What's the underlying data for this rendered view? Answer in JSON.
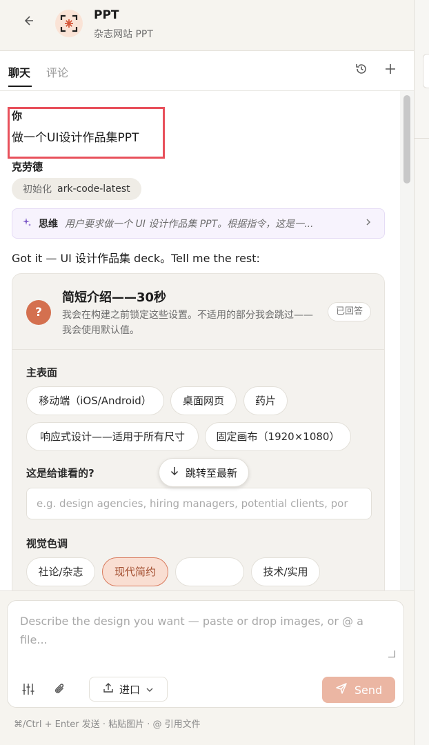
{
  "header": {
    "title": "PPT",
    "subtitle": "杂志网站 PPT"
  },
  "tabs": {
    "chat": "聊天",
    "comments": "评论"
  },
  "conversation": {
    "user_label": "你",
    "user_message": "做一个UI设计作品集PPT",
    "assistant_label": "克劳德",
    "init_key": "初始化",
    "init_value": "ark-code-latest",
    "thinking_label": "思维",
    "thinking_text": "用户要求做一个 UI 设计作品集 PPT。根据指令，这是一...",
    "reply": "Got it — UI 设计作品集 deck。Tell me the rest:"
  },
  "question_card": {
    "title": "简短介绍——30秒",
    "description": "我会在构建之前锁定这些设置。不适用的部分我会跳过——我会使用默认值。",
    "answered_badge": "已回答",
    "surface_label": "主表面",
    "surface_options": [
      "移动端（iOS/Android）",
      "桌面网页",
      "药片",
      "响应式设计——适用于所有尺寸",
      "固定画布（1920×1080）"
    ],
    "audience_label": "这是给谁看的?",
    "audience_placeholder": "e.g. design agencies, hiring managers, potential clients, por",
    "tone_label": "视觉色调",
    "tone_options": [
      "社论/杂志",
      "现代简约",
      "技术/实用"
    ],
    "tone_selected": "现代简约"
  },
  "jump_to_latest": "跳转至最新",
  "composer": {
    "placeholder": "Describe the design you want — paste or drop images, or @ a file...",
    "import_label": "进口",
    "send_label": "Send",
    "hint": "⌘/Ctrl + Enter 发送 · 粘贴图片 · @ 引用文件"
  },
  "colors": {
    "accent": "#d4704f",
    "send_disabled": "#ebb6a3",
    "highlight_box": "#e8505b",
    "thinking_accent": "#7b57c7"
  },
  "icons": {
    "back": "back-arrow-icon",
    "app": "focus-spark-icon",
    "history": "history-icon",
    "add": "plus-icon",
    "thinking": "sparkle-icon",
    "expand": "chevron-right-icon",
    "question": "question-mark-icon",
    "jump": "arrow-down-icon",
    "settings": "sliders-icon",
    "attach": "paperclip-icon",
    "import": "upload-icon",
    "dropdown": "chevron-down-icon",
    "send": "send-icon"
  }
}
